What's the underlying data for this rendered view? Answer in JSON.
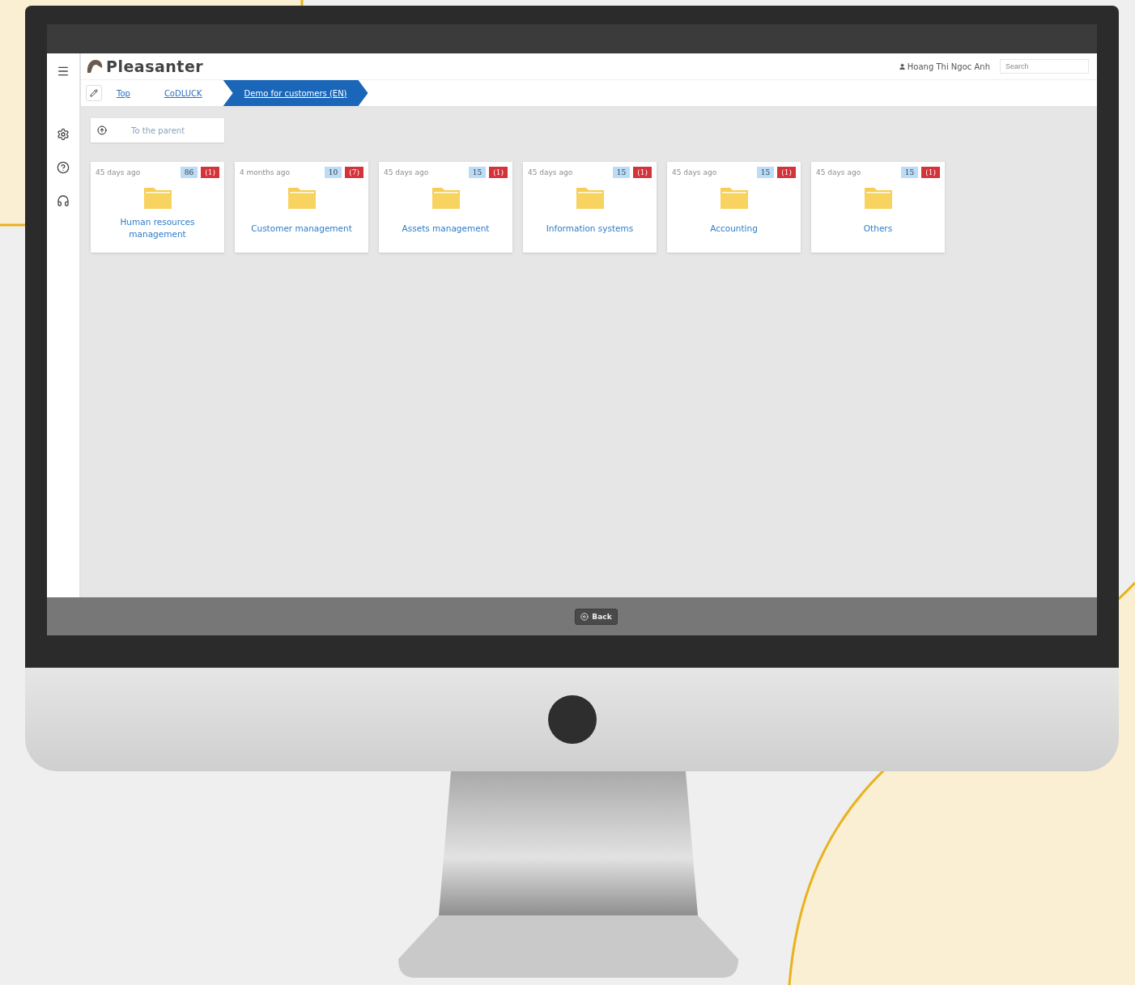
{
  "app": {
    "logo": "Pleasanter",
    "user": "Hoang Thi Ngoc Anh",
    "search": {
      "placeholder": "Search"
    }
  },
  "breadcrumbs": [
    {
      "label": "Top",
      "selected": false
    },
    {
      "label": "CoDLUCK",
      "selected": false
    },
    {
      "label": "Demo for customers (EN)",
      "selected": true
    }
  ],
  "parent_button": "To the parent",
  "folders": [
    {
      "updated": "45 days ago",
      "count": "86",
      "alerts": "(1)",
      "title": "Human resources management"
    },
    {
      "updated": "4 months ago",
      "count": "10",
      "alerts": "(7)",
      "title": "Customer management"
    },
    {
      "updated": "45 days ago",
      "count": "15",
      "alerts": "(1)",
      "title": "Assets management"
    },
    {
      "updated": "45 days ago",
      "count": "15",
      "alerts": "(1)",
      "title": "Information systems"
    },
    {
      "updated": "45 days ago",
      "count": "15",
      "alerts": "(1)",
      "title": "Accounting"
    },
    {
      "updated": "45 days ago",
      "count": "15",
      "alerts": "(1)",
      "title": "Others"
    }
  ],
  "footer": {
    "back_button": "Back"
  }
}
